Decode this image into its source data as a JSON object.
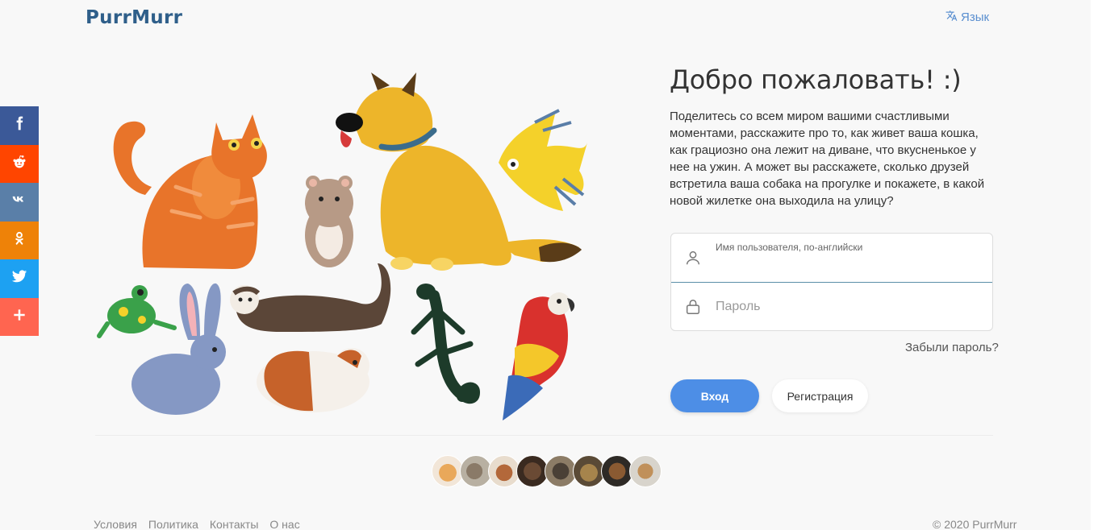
{
  "header": {
    "logo": "PurrMurr",
    "language_label": "Язык"
  },
  "social": [
    {
      "name": "facebook",
      "color": "#3b5998",
      "glyph": "f"
    },
    {
      "name": "reddit",
      "color": "#ff4500",
      "glyph": "reddit"
    },
    {
      "name": "vk",
      "color": "#5a7fa8",
      "glyph": "vk"
    },
    {
      "name": "odnoklassniki",
      "color": "#ee8208",
      "glyph": "ok"
    },
    {
      "name": "twitter",
      "color": "#1da1f2",
      "glyph": "tw"
    },
    {
      "name": "more",
      "color": "#ff6550",
      "glyph": "+"
    }
  ],
  "welcome": {
    "title": "Добро пожаловать! :)",
    "text": "Поделитесь со всем миром вашими счастливыми моментами, расскажите про то, как живет ваша кошка, как грациозно она лежит на диване, что вкусненькое у нее на ужин. А может вы расскажете, сколько друзей встретила ваша собака на прогулке и покажете, в какой новой жилетке она выходила на улицу?"
  },
  "form": {
    "username_label": "Имя пользователя, по-английски",
    "username_value": "",
    "password_placeholder": "Пароль",
    "forgot_label": "Забыли пароль?",
    "login_label": "Вход",
    "register_label": "Регистрация"
  },
  "footer": {
    "links": [
      "Условия",
      "Политика",
      "Контакты",
      "О нас"
    ],
    "copyright": "© 2020 PurrMurr"
  },
  "colors": {
    "accent": "#4d8ee6",
    "logo": "#2f5f8a"
  }
}
